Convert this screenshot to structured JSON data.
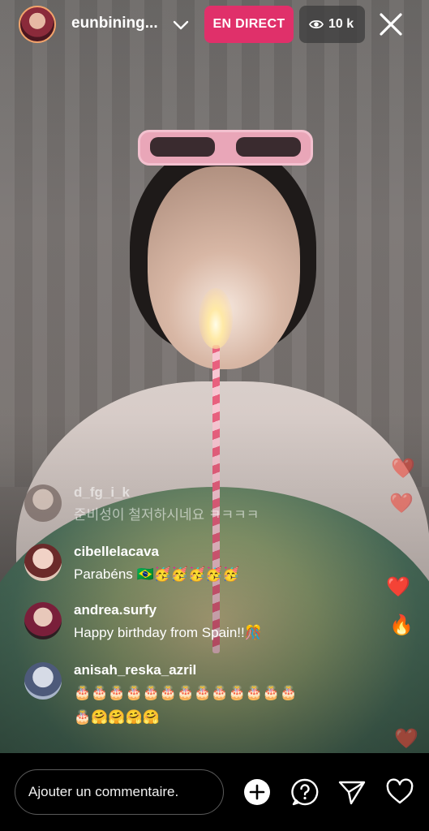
{
  "header": {
    "host_username": "eunbining...",
    "live_label": "EN DIRECT",
    "viewer_count": "10 k"
  },
  "comments": [
    {
      "username": "d_fg_i_k",
      "text": "준비성이 철저하시네요 ㅋㅋㅋㅋ",
      "faded": true
    },
    {
      "username": "cibellelacava",
      "text": "Parabéns 🇧🇷🥳🥳🥳🥳🥳"
    },
    {
      "username": "andrea.surfy",
      "text": "Happy birthday from Spain!!🎊"
    },
    {
      "username": "anisah_reska_azril",
      "line1": "🎂🎂🎂🎂🎂🎂🎂🎂🎂🎂🎂🎂🎂",
      "line2": "🎂🤗🤗🤗🤗"
    }
  ],
  "reactions": [
    "heart",
    "heart",
    "heart",
    "fire",
    "heart"
  ],
  "footer": {
    "comment_placeholder": "Ajouter un commentaire.",
    "icons": [
      "add-icon",
      "question-icon",
      "send-icon",
      "heart-icon"
    ]
  },
  "colors": {
    "live_badge": "#e0306a",
    "viewer_badge": "#3c3c3c",
    "background": "#000000"
  }
}
